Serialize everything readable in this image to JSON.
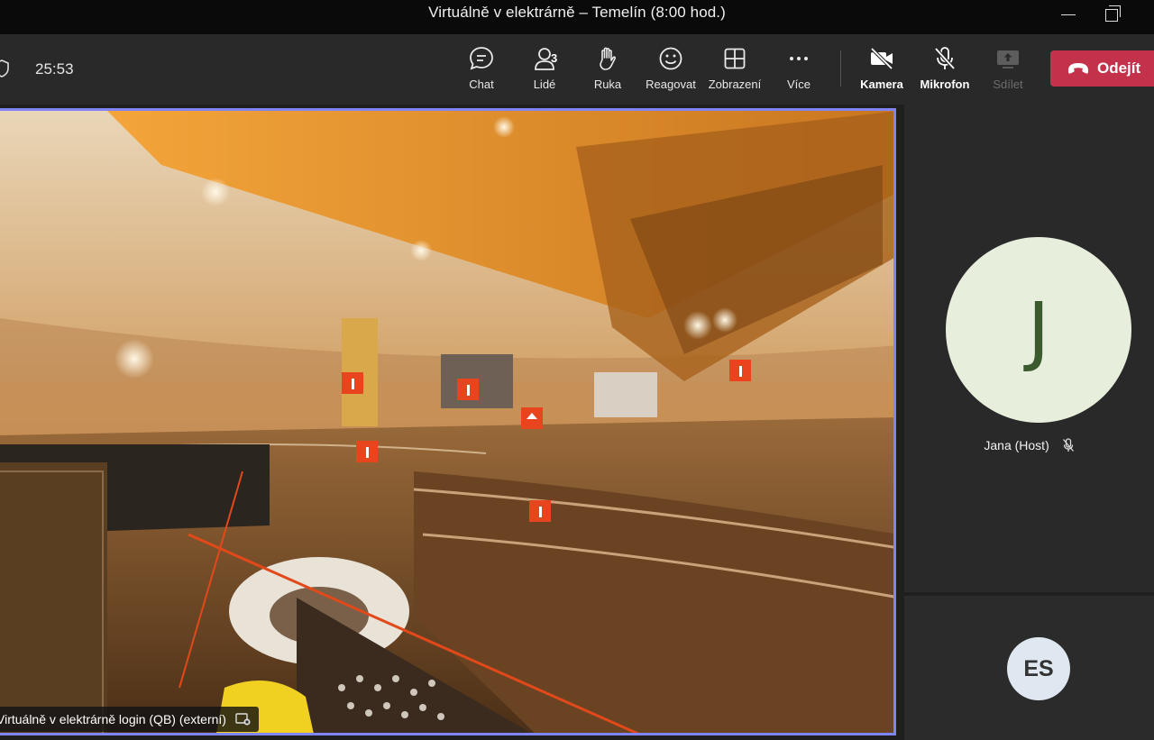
{
  "window": {
    "title": "Virtuálně v elektrárně – Temelín (8:00 hod.)"
  },
  "toolbar": {
    "timer": "25:53",
    "items": [
      {
        "label": "Chat",
        "icon": "chat-icon"
      },
      {
        "label": "Lidé",
        "icon": "people-icon",
        "badge": "3"
      },
      {
        "label": "Ruka",
        "icon": "raise-hand-icon"
      },
      {
        "label": "Reagovat",
        "icon": "smiley-icon"
      },
      {
        "label": "Zobrazení",
        "icon": "grid-view-icon"
      },
      {
        "label": "Více",
        "icon": "more-icon"
      }
    ],
    "camera_label": "Kamera",
    "mic_label": "Mikrofon",
    "share_label": "Sdílet",
    "leave_label": "Odejít"
  },
  "stage": {
    "presenter_caption": "Virtuálně v elektrárně login (QB) (externí)"
  },
  "participants": {
    "main": {
      "initial": "J",
      "name": "Jana (Host)",
      "muted": true,
      "avatar_color": "#e7eedc"
    },
    "secondary": {
      "initials": "ES",
      "avatar_color": "#dfe8f0"
    }
  },
  "colors": {
    "accent_border": "#7f85f5",
    "leave_button": "#c4314b"
  }
}
